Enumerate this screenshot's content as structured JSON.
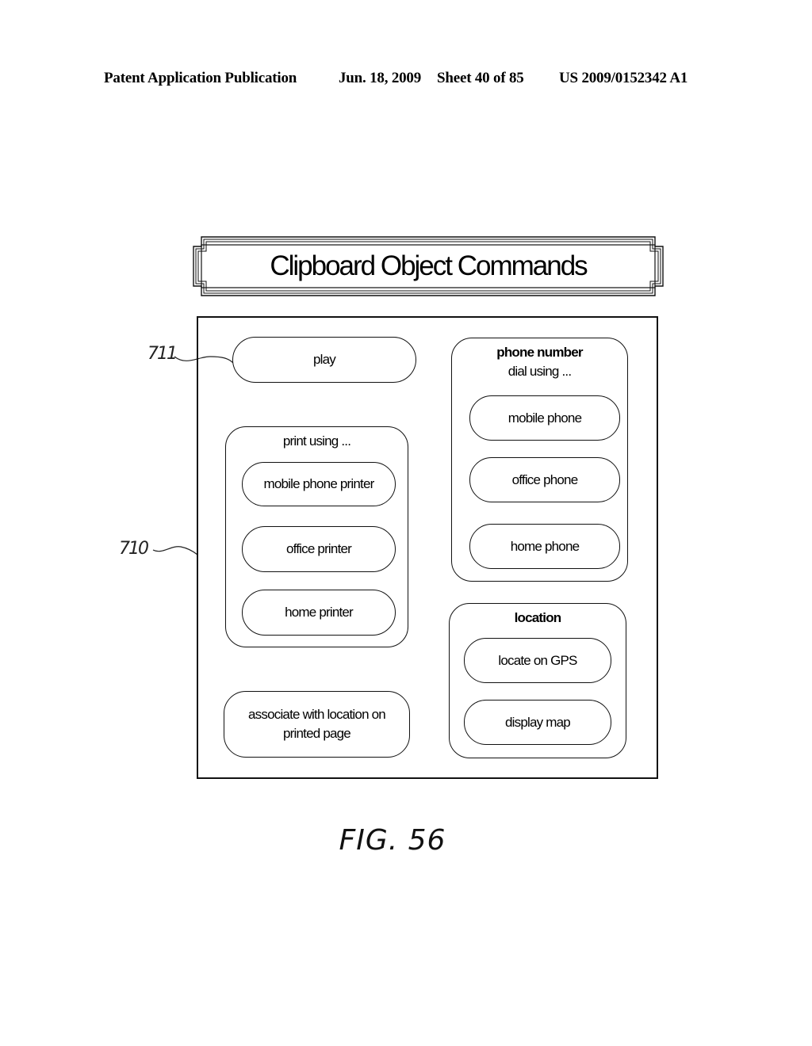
{
  "header": {
    "publication": "Patent Application Publication",
    "date": "Jun. 18, 2009",
    "sheet": "Sheet 40 of 85",
    "number": "US 2009/0152342 A1"
  },
  "diagram": {
    "title": "Clipboard Object Commands",
    "references": {
      "panel": "710",
      "play_command": "711"
    },
    "commands": {
      "play": "play",
      "print_group": {
        "label": "print using ...",
        "items": [
          "mobile phone printer",
          "office printer",
          "home printer"
        ]
      },
      "associate": "associate with location on printed page",
      "phone_group": {
        "title": "phone number",
        "label": "dial using ...",
        "items": [
          "mobile phone",
          "office phone",
          "home phone"
        ]
      },
      "location_group": {
        "title": "location",
        "items": [
          "locate on GPS",
          "display map"
        ]
      }
    }
  },
  "figure_label": "FIG. 56"
}
